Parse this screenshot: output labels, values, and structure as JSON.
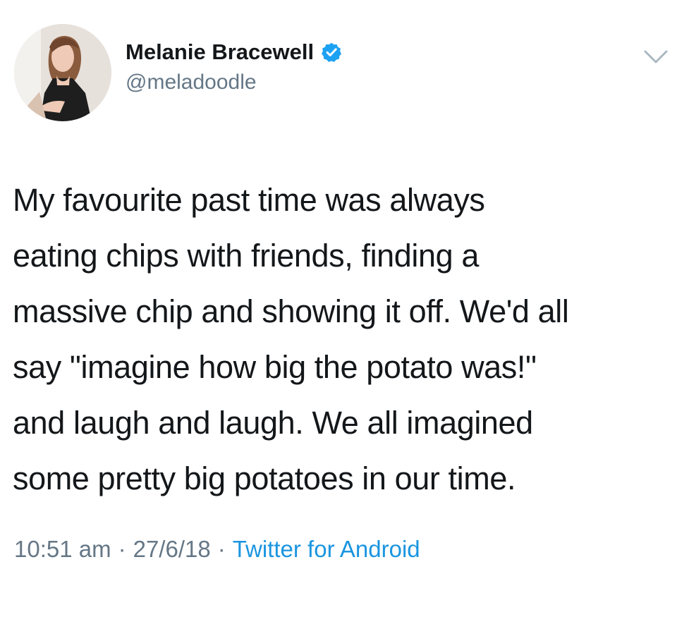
{
  "tweet": {
    "author": {
      "display_name": "Melanie Bracewell",
      "handle": "@meladoodle",
      "verified": true,
      "avatar": "profile-photo"
    },
    "text_lines": [
      "My favourite past time was always",
      "eating chips with friends, finding a",
      "massive chip and showing it off. We'd all",
      "say \"imagine how big the potato was!\"",
      "and laugh and laugh. We all imagined",
      "some pretty big potatoes in our time."
    ],
    "meta": {
      "time": "10:51 am",
      "separator": "·",
      "date": "27/6/18",
      "source": "Twitter for Android"
    },
    "icons": {
      "verified": "verified-badge-icon",
      "menu": "chevron-down-icon"
    }
  },
  "colors": {
    "text": "#14171a",
    "secondary_text": "#657786",
    "accent": "#1b95e0",
    "background": "#ffffff"
  }
}
